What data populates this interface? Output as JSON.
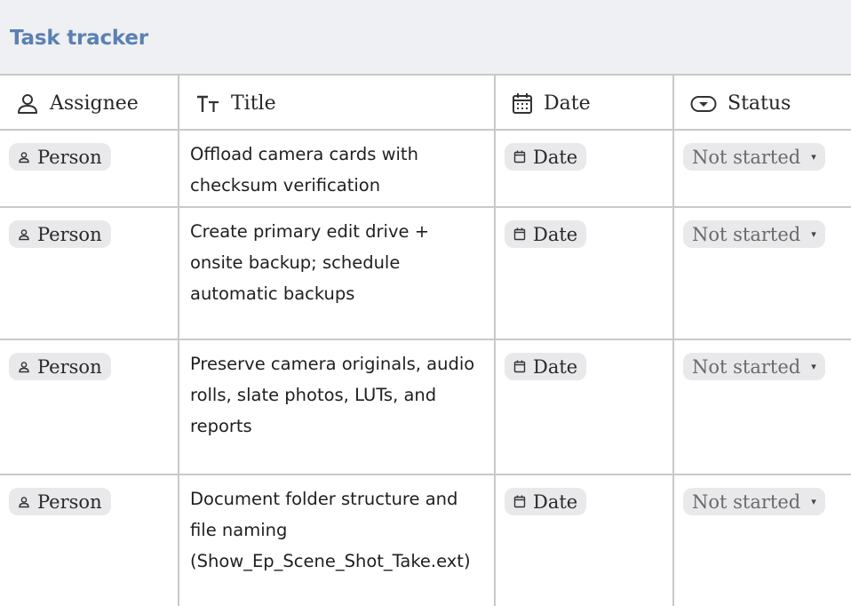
{
  "app": {
    "title": "Task tracker"
  },
  "columns": [
    {
      "label": "Assignee",
      "icon": "person-icon"
    },
    {
      "label": "Title",
      "icon": "text-format-icon"
    },
    {
      "label": "Date",
      "icon": "calendar-icon"
    },
    {
      "label": "Status",
      "icon": "status-toggle-icon"
    }
  ],
  "rows": [
    {
      "assignee": "Person",
      "title": "Offload camera cards with checksum verification",
      "date": "Date",
      "status": "Not started"
    },
    {
      "assignee": "Person",
      "title": "Create primary edit drive + onsite backup; schedule automatic backups",
      "date": "Date",
      "status": "Not started"
    },
    {
      "assignee": "Person",
      "title": "Preserve camera originals, audio rolls, slate photos, LUTs, and reports",
      "date": "Date",
      "status": "Not started"
    },
    {
      "assignee": "Person",
      "title": "Document folder structure and file naming (Show_Ep_Scene_Shot_Take.ext)",
      "date": "Date",
      "status": "Not started"
    }
  ],
  "colors": {
    "title": "#5b80b2",
    "header_bg": "#eef0f3",
    "chip_bg": "#e9e9ec",
    "grid": "#c9c9c9"
  }
}
